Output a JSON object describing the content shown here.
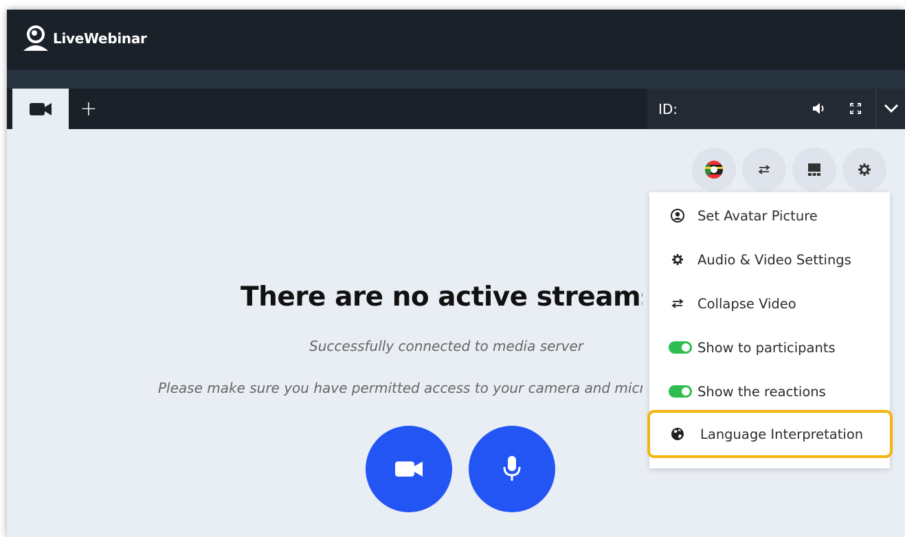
{
  "app": {
    "brand": "LiveWebinar"
  },
  "tabs": {
    "add_label": "+"
  },
  "stream_bar": {
    "id_label": "ID:"
  },
  "toolbar": {
    "buttons": [
      {
        "icon": "language-flag-icon"
      },
      {
        "icon": "swap-arrows-icon"
      },
      {
        "icon": "layout-icon"
      },
      {
        "icon": "gear-icon"
      }
    ]
  },
  "menu": {
    "items": [
      {
        "label": "Set Avatar Picture",
        "icon": "user-circle-icon"
      },
      {
        "label": "Audio & Video Settings",
        "icon": "gear-icon"
      },
      {
        "label": "Collapse Video",
        "icon": "swap-arrows-icon"
      },
      {
        "label": "Show to participants",
        "toggle": true
      },
      {
        "label": "Show the reactions",
        "toggle": true
      },
      {
        "label": "Language Interpretation",
        "icon": "globe-icon"
      }
    ]
  },
  "main": {
    "headline": "There are no active streams",
    "status": "Successfully connected to media server",
    "hint": "Please make sure you have permitted access to your camera and microphone"
  },
  "colors": {
    "topbar": "#1b2129",
    "accent_blue": "#2355f5",
    "toggle_green": "#2ebd4e",
    "highlight": "#f2b50b"
  }
}
